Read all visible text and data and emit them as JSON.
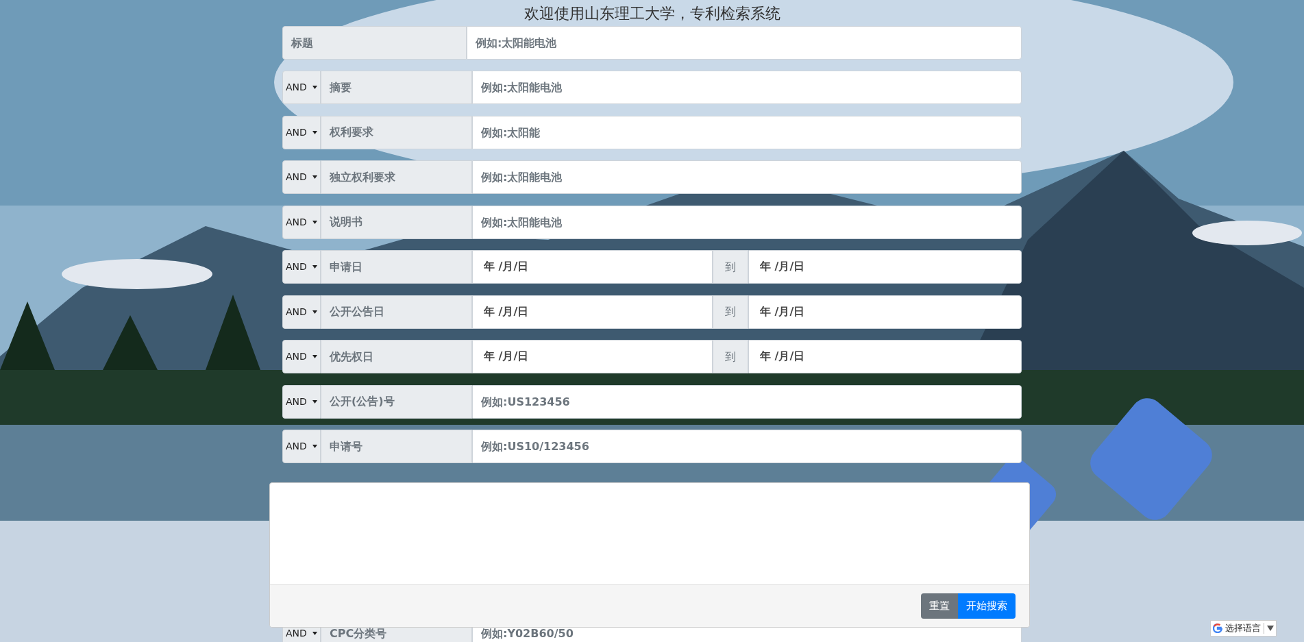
{
  "page_title": "欢迎使用山东理工大学，专利检索系统",
  "title_row": {
    "label": "标题",
    "placeholder": "例如:太阳能电池"
  },
  "rows": [
    {
      "kind": "text",
      "operator": "AND",
      "label": "摘要",
      "placeholder": "例如:太阳能电池"
    },
    {
      "kind": "text",
      "operator": "AND",
      "label": "权利要求",
      "placeholder": "例如:太阳能"
    },
    {
      "kind": "text",
      "operator": "AND",
      "label": "独立权利要求",
      "placeholder": "例如:太阳能电池"
    },
    {
      "kind": "text",
      "operator": "AND",
      "label": "说明书",
      "placeholder": "例如:太阳能电池"
    },
    {
      "kind": "date",
      "operator": "AND",
      "label": "申请日",
      "from": "年 /月/日",
      "to_label": "到",
      "to": "年 /月/日"
    },
    {
      "kind": "date",
      "operator": "AND",
      "label": "公开公告日",
      "from": "年 /月/日",
      "to_label": "到",
      "to": "年 /月/日"
    },
    {
      "kind": "date",
      "operator": "AND",
      "label": "优先权日",
      "from": "年 /月/日",
      "to_label": "到",
      "to": "年 /月/日"
    },
    {
      "kind": "text",
      "operator": "AND",
      "label": "公开(公告)号",
      "placeholder": "例如:US123456"
    },
    {
      "kind": "text",
      "operator": "AND",
      "label": "申请号",
      "placeholder": "例如:US10/123456"
    }
  ],
  "bottom_row": {
    "operator": "AND",
    "label": "CPC分类号",
    "placeholder": "例如:Y02B60/50"
  },
  "panel": {
    "buttons": [
      {
        "kind": "secondary",
        "label": "重置"
      },
      {
        "kind": "primary",
        "label": "开始搜索"
      }
    ]
  },
  "language_widget": {
    "label": "选择语言"
  }
}
